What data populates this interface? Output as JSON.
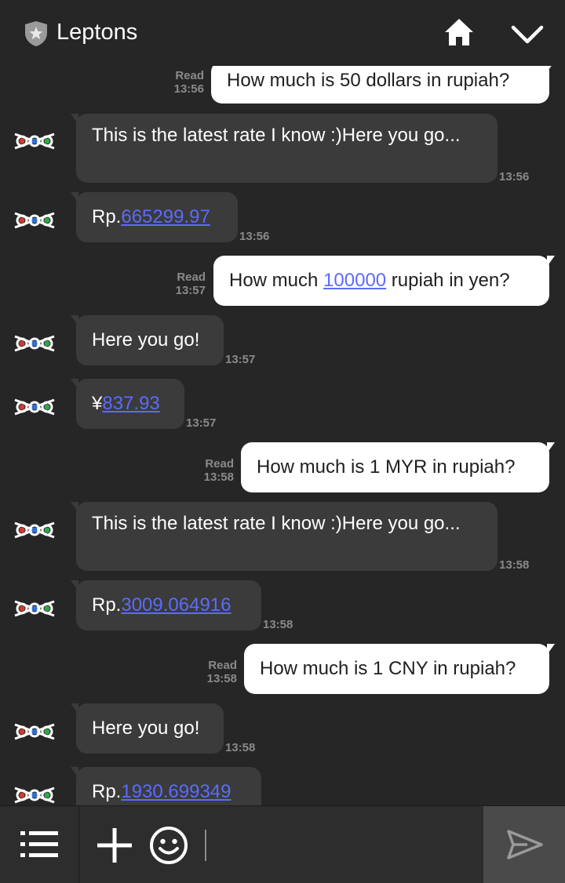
{
  "header": {
    "title": "Leptons",
    "icons": [
      "shield-star-icon",
      "home-icon",
      "chevron-down-icon"
    ]
  },
  "messages": [
    {
      "dir": "out",
      "text": "How much is 50 dollars in rupiah?",
      "status": "Read",
      "time": "13:56"
    },
    {
      "dir": "in",
      "text": "This is the latest rate I know :)Here you go...",
      "time": "13:56"
    },
    {
      "dir": "in",
      "prefix": "Rp.",
      "link": "665299.97",
      "time": "13:56"
    },
    {
      "dir": "out",
      "pre": "How much ",
      "link": "100000",
      "post": " rupiah in yen?",
      "status": "Read",
      "time": "13:57"
    },
    {
      "dir": "in",
      "text": "Here you go!",
      "time": "13:57"
    },
    {
      "dir": "in",
      "prefix": "¥",
      "link": "837.93",
      "time": "13:57"
    },
    {
      "dir": "out",
      "text": "How much is 1 MYR in rupiah?",
      "status": "Read",
      "time": "13:58"
    },
    {
      "dir": "in",
      "text": "This is the latest rate I know :)Here you go...",
      "time": "13:58"
    },
    {
      "dir": "in",
      "prefix": "Rp.",
      "link": "3009.064916",
      "time": "13:58"
    },
    {
      "dir": "out",
      "text": "How much is 1 CNY in rupiah?",
      "status": "Read",
      "time": "13:58"
    },
    {
      "dir": "in",
      "text": "Here you go!",
      "time": "13:58"
    },
    {
      "dir": "in",
      "prefix": "Rp.",
      "link": "1930.699349",
      "time": ""
    }
  ],
  "footer": {
    "input_value": "",
    "icons": [
      "menu-icon",
      "plus-icon",
      "emoji-icon",
      "send-icon"
    ]
  },
  "colors": {
    "background": "#262626",
    "incoming_bubble": "#3b3b3b",
    "outgoing_bubble": "#ffffff",
    "link": "#5b6bff",
    "meta": "#8a8a8a"
  }
}
